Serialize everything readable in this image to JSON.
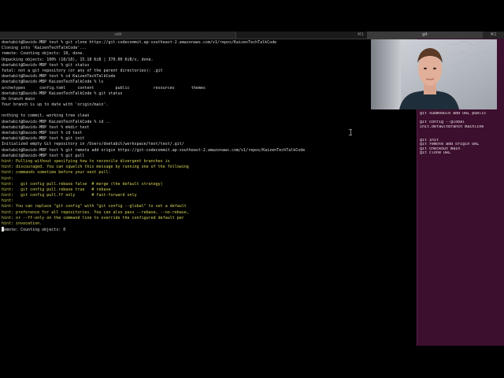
{
  "tabs": [
    {
      "label": "-zsh",
      "shortcut": ""
    },
    {
      "label": "",
      "shortcut": "⌘1"
    },
    {
      "label": "git",
      "shortcut": ""
    },
    {
      "label": "",
      "shortcut": "⌘1"
    }
  ],
  "terminal": {
    "lines": [
      {
        "text": "doetabit@Davids-MBP test % git clone https://git-codecommit.ap-southeast-2.amazonaws.com/v1/repos/KaizenTechTalkCode",
        "style": "normal"
      },
      {
        "text": "Cloning into 'KaizenTechTalkCode'...",
        "style": "normal"
      },
      {
        "text": "remote: Counting objects: 18, done.",
        "style": "normal"
      },
      {
        "text": "Unpacking objects: 100% (18/18), 15.18 KiB | 370.00 KiB/s, done.",
        "style": "normal"
      },
      {
        "text": "doetabit@Davids-MBP test % git status",
        "style": "normal"
      },
      {
        "text": "fatal: not a git repository (or any of the parent directories): .git",
        "style": "normal"
      },
      {
        "text": "doetabit@Davids-MBP test % cd KaizenTechTalkCode",
        "style": "normal"
      },
      {
        "text": "doetabit@Davids-MBP KaizenTechTalkCode % ls",
        "style": "normal"
      },
      {
        "text": "archetypes      config.toml     content         public          resources       themes",
        "style": "normal"
      },
      {
        "text": "doetabit@Davids-MBP KaizenTechTalkCode % git status",
        "style": "normal"
      },
      {
        "text": "On branch main",
        "style": "normal"
      },
      {
        "text": "Your branch is up to date with 'origin/main'.",
        "style": "normal"
      },
      {
        "text": "",
        "style": "normal"
      },
      {
        "text": "nothing to commit, working tree clean",
        "style": "normal"
      },
      {
        "text": "doetabit@Davids-MBP KaizenTechTalkCode % cd ..",
        "style": "normal"
      },
      {
        "text": "doetabit@Davids-MBP test % mkdir test",
        "style": "normal"
      },
      {
        "text": "doetabit@Davids-MBP test % cd test",
        "style": "normal"
      },
      {
        "text": "doetabit@Davids-MBP test % git init",
        "style": "normal"
      },
      {
        "text": "Initialized empty Git repository in /Users/doetabit/workspace/test/test/.git/",
        "style": "normal"
      },
      {
        "text": "doetabit@Davids-MBP test % git remote add origin https://git-codecommit.ap-southeast-2.amazonaws.com/v1/repos/KaizenTechTalkCode",
        "style": "normal"
      },
      {
        "text": "doetabit@Davids-MBP test % git pull",
        "style": "normal"
      },
      {
        "text": "hint: Pulling without specifying how to reconcile divergent branches is",
        "style": "hint"
      },
      {
        "text": "hint: discouraged. You can squelch this message by running one of the following",
        "style": "hint"
      },
      {
        "text": "hint: commands sometime before your next pull:",
        "style": "hint"
      },
      {
        "text": "hint:",
        "style": "hint"
      },
      {
        "text": "hint:   git config pull.rebase false  # merge (the default strategy)",
        "style": "hint"
      },
      {
        "text": "hint:   git config pull.rebase true   # rebase",
        "style": "hint"
      },
      {
        "text": "hint:   git config pull.ff only       # fast-forward only",
        "style": "hint"
      },
      {
        "text": "hint:",
        "style": "hint"
      },
      {
        "text": "hint: You can replace \"git config\" with \"git config --global\" to set a default",
        "style": "hint"
      },
      {
        "text": "hint: preference for all repositories. You can also pass --rebase, --no-rebase,",
        "style": "hint"
      },
      {
        "text": "hint: or --ff-only on the command line to override the configured default per",
        "style": "hint"
      },
      {
        "text": "hint: invocation.",
        "style": "hint"
      }
    ],
    "current_line": "emote: Counting objects: 0"
  },
  "notes": [
    "git submodule add URL public",
    "",
    "git config --global",
    "init.defaultBranch mainline",
    "",
    "",
    "git init",
    "git remote add origin URL",
    "git checkout main",
    "git clone URL"
  ],
  "colors": {
    "terminal_bg": "#000000",
    "terminal_fg": "#d8d8d8",
    "hint": "#d7d35b",
    "notes_bg": "#3b0f2d",
    "tab_bar": "#262626"
  }
}
